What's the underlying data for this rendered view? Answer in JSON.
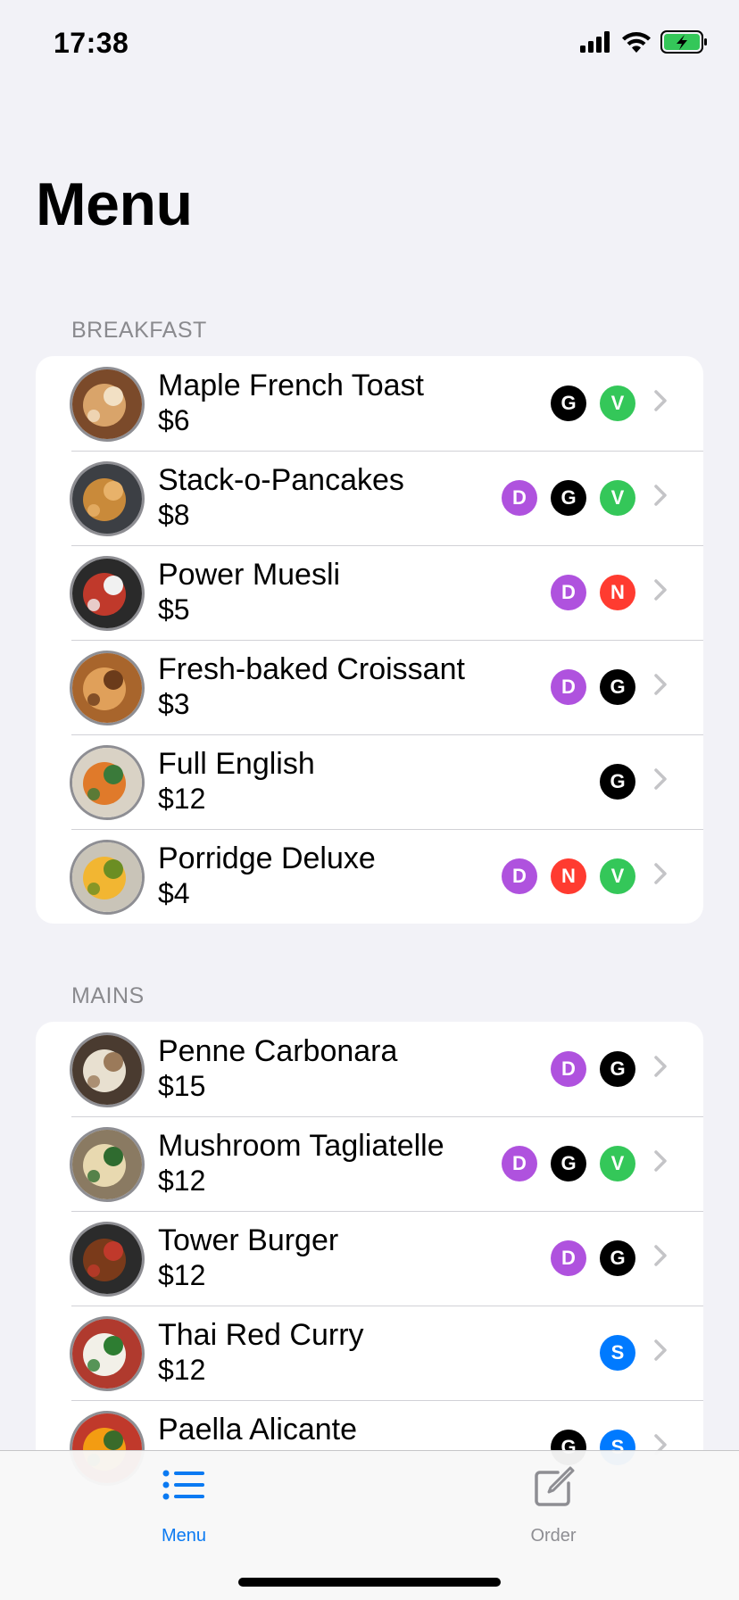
{
  "status_bar": {
    "time": "17:38"
  },
  "nav": {
    "title": "Menu"
  },
  "colors": {
    "accent": "#0a7af2",
    "D": "#af52de",
    "G": "#000000",
    "V": "#34c759",
    "N": "#ff3b30",
    "S": "#007aff"
  },
  "sections": [
    {
      "header": "BREAKFAST",
      "items": [
        {
          "name": "Maple French Toast",
          "price": "$6",
          "badges": [
            "G",
            "V"
          ]
        },
        {
          "name": "Stack-o-Pancakes",
          "price": "$8",
          "badges": [
            "D",
            "G",
            "V"
          ]
        },
        {
          "name": "Power Muesli",
          "price": "$5",
          "badges": [
            "D",
            "N"
          ]
        },
        {
          "name": "Fresh-baked Croissant",
          "price": "$3",
          "badges": [
            "D",
            "G"
          ]
        },
        {
          "name": "Full English",
          "price": "$12",
          "badges": [
            "G"
          ]
        },
        {
          "name": "Porridge Deluxe",
          "price": "$4",
          "badges": [
            "D",
            "N",
            "V"
          ]
        }
      ]
    },
    {
      "header": "MAINS",
      "items": [
        {
          "name": "Penne Carbonara",
          "price": "$15",
          "badges": [
            "D",
            "G"
          ]
        },
        {
          "name": "Mushroom Tagliatelle",
          "price": "$12",
          "badges": [
            "D",
            "G",
            "V"
          ]
        },
        {
          "name": "Tower Burger",
          "price": "$12",
          "badges": [
            "D",
            "G"
          ]
        },
        {
          "name": "Thai Red Curry",
          "price": "$12",
          "badges": [
            "S"
          ]
        },
        {
          "name": "Paella Alicante",
          "price": "",
          "badges": [
            "G",
            "S"
          ]
        }
      ]
    }
  ],
  "tabbar": {
    "tabs": [
      {
        "label": "Menu",
        "icon": "list-icon",
        "selected": true
      },
      {
        "label": "Order",
        "icon": "compose-icon",
        "selected": false
      }
    ]
  }
}
